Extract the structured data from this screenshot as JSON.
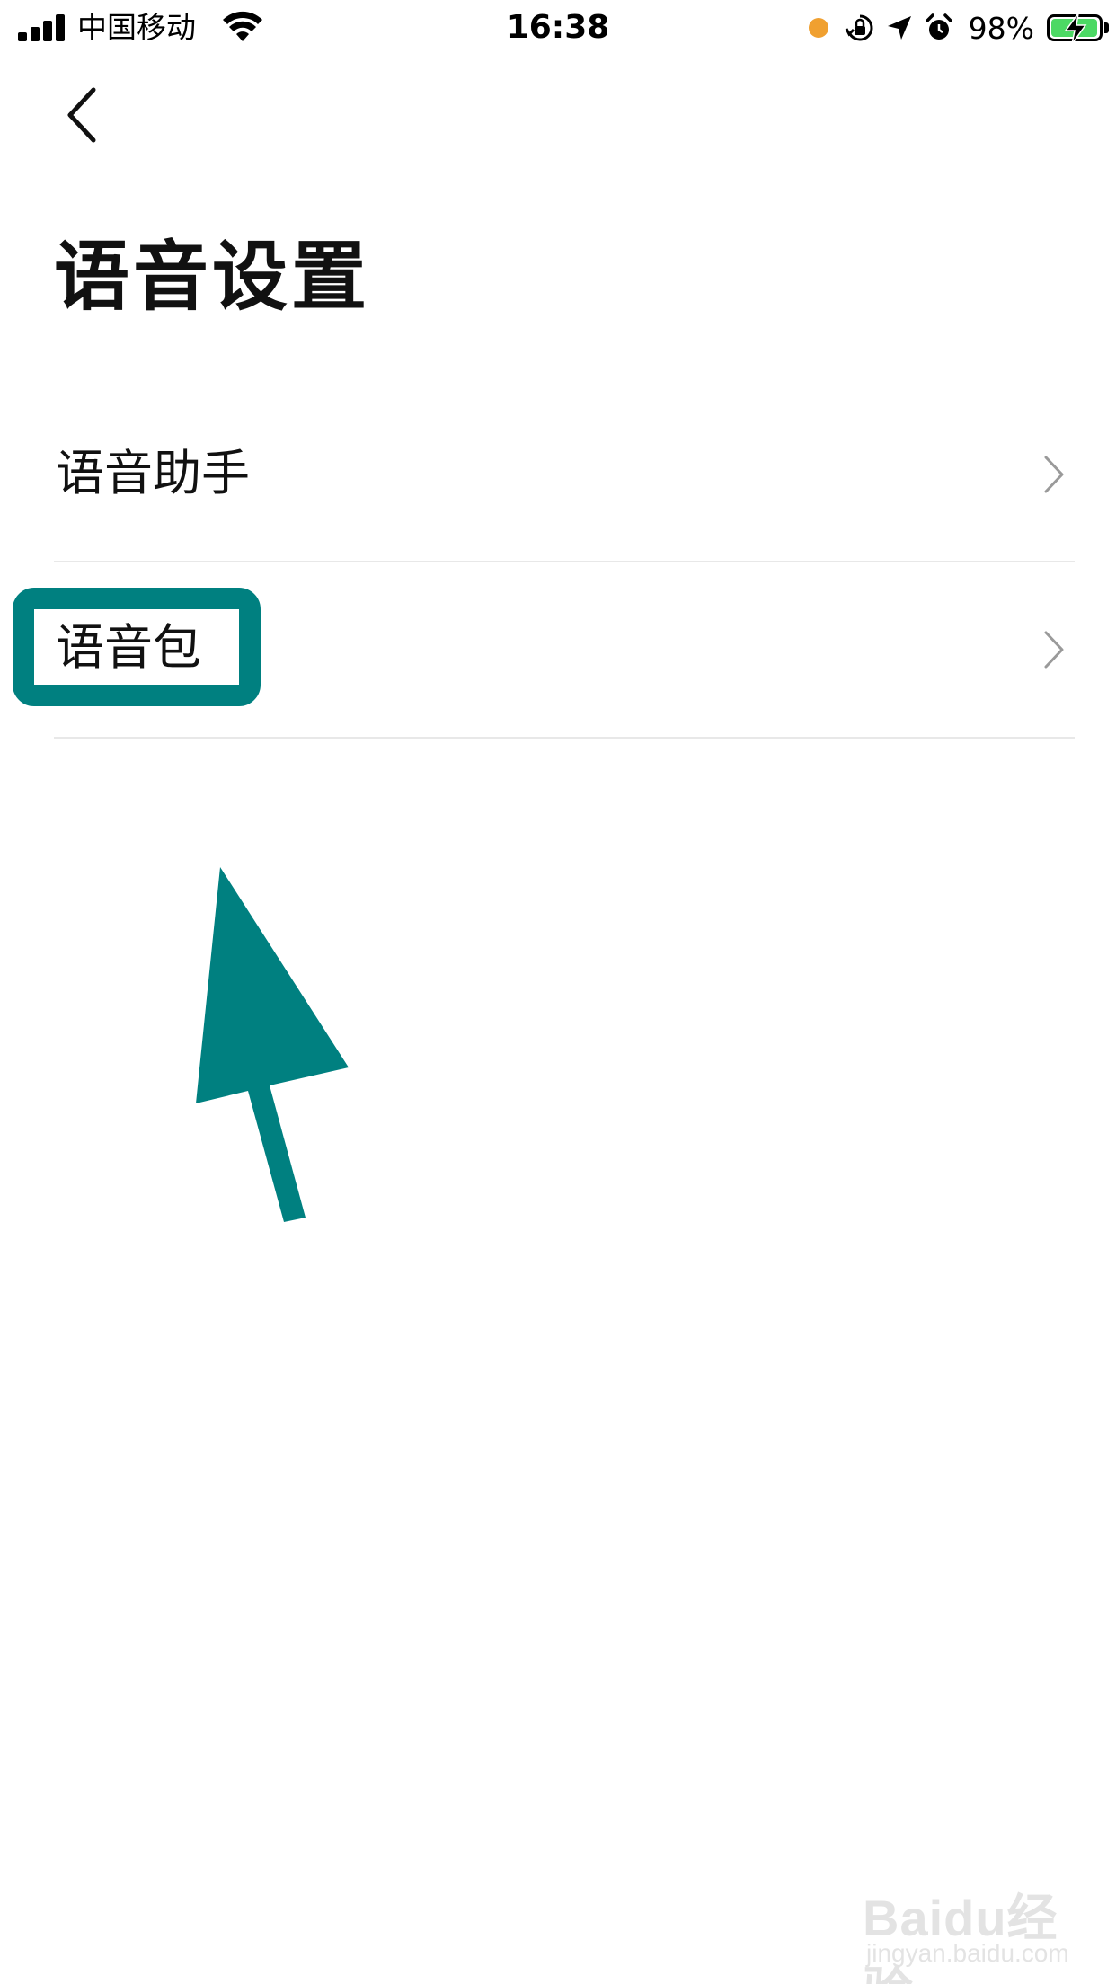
{
  "status_bar": {
    "carrier": "中国移动",
    "time": "16:38",
    "battery_percent": "98%",
    "battery_level": 0.98,
    "icons": [
      "signal-icon",
      "wifi-icon",
      "recording-dot-icon",
      "orientation-lock-icon",
      "location-icon",
      "alarm-icon",
      "battery-charging-icon"
    ],
    "colors": {
      "recording_dot": "#f0a030",
      "battery_fill": "#4cd964"
    }
  },
  "nav": {
    "back_icon": "chevron-left-icon"
  },
  "page": {
    "title": "语音设置"
  },
  "settings": {
    "items": [
      {
        "label": "语音助手",
        "icon": "chevron-right-icon"
      },
      {
        "label": "语音包",
        "icon": "chevron-right-icon"
      }
    ]
  },
  "annotation": {
    "highlight_color": "#008080",
    "arrow_color": "#008080",
    "target": "语音包"
  },
  "watermark": {
    "brand": "Baidu经验",
    "url": "jingyan.baidu.com"
  }
}
